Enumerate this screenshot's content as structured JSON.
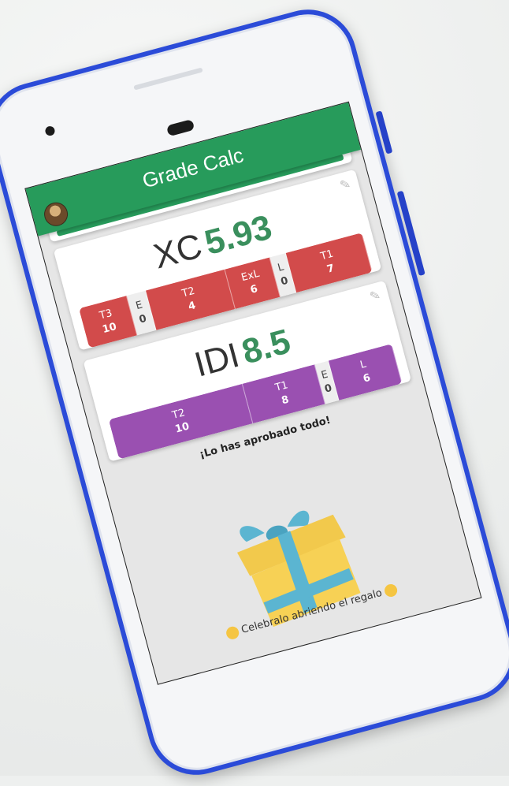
{
  "app": {
    "title": "Grade Calc",
    "add_label": "+"
  },
  "subjects": [
    {
      "code": "XC",
      "grade": "5.93",
      "color": "#d24b4b",
      "items": [
        {
          "label": "T3",
          "value": "10"
        },
        {
          "label": "E",
          "value": "0"
        },
        {
          "label": "T2",
          "value": "4"
        },
        {
          "label": "ExL",
          "value": "6"
        },
        {
          "label": "L",
          "value": "0"
        },
        {
          "label": "T1",
          "value": "7"
        }
      ]
    },
    {
      "code": "IDI",
      "grade": "8.5",
      "color": "#9a50b1",
      "items": [
        {
          "label": "T2",
          "value": "10"
        },
        {
          "label": "T1",
          "value": "8"
        },
        {
          "label": "E",
          "value": "0"
        },
        {
          "label": "L",
          "value": "6"
        }
      ]
    }
  ],
  "message": "¡Lo has aprobado todo!",
  "celebrate": "Celebralo abriendo el regalo",
  "icons": {
    "edit": "pencil-icon",
    "gift": "gift-box-icon",
    "avatar": "avatar-icon"
  }
}
